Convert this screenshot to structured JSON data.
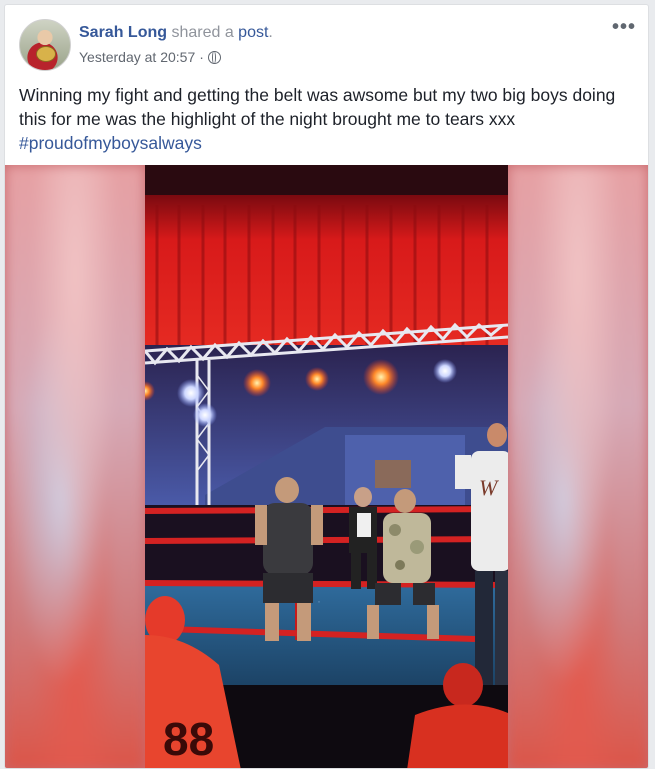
{
  "post": {
    "author": "Sarah Long",
    "action_text": " shared a ",
    "action_link": "post",
    "period": ".",
    "timestamp": "Yesterday at 20:57",
    "separator": "·",
    "more_label": "•••",
    "text": "Winning my fight and getting the belt was awsome but my two big boys doing this for me was the highlight of the night brought me to tears xxx",
    "hashtag": "#proudofmyboysalways"
  },
  "video": {
    "shirt_number": "88"
  },
  "colors": {
    "link": "#365899",
    "text": "#1d2129",
    "meta": "#616770",
    "curtain": "#d01616",
    "mat": "#2a5c8a",
    "rope": "#d32020"
  },
  "icons": {
    "privacy": "globe-icon",
    "options": "more-options-icon"
  }
}
